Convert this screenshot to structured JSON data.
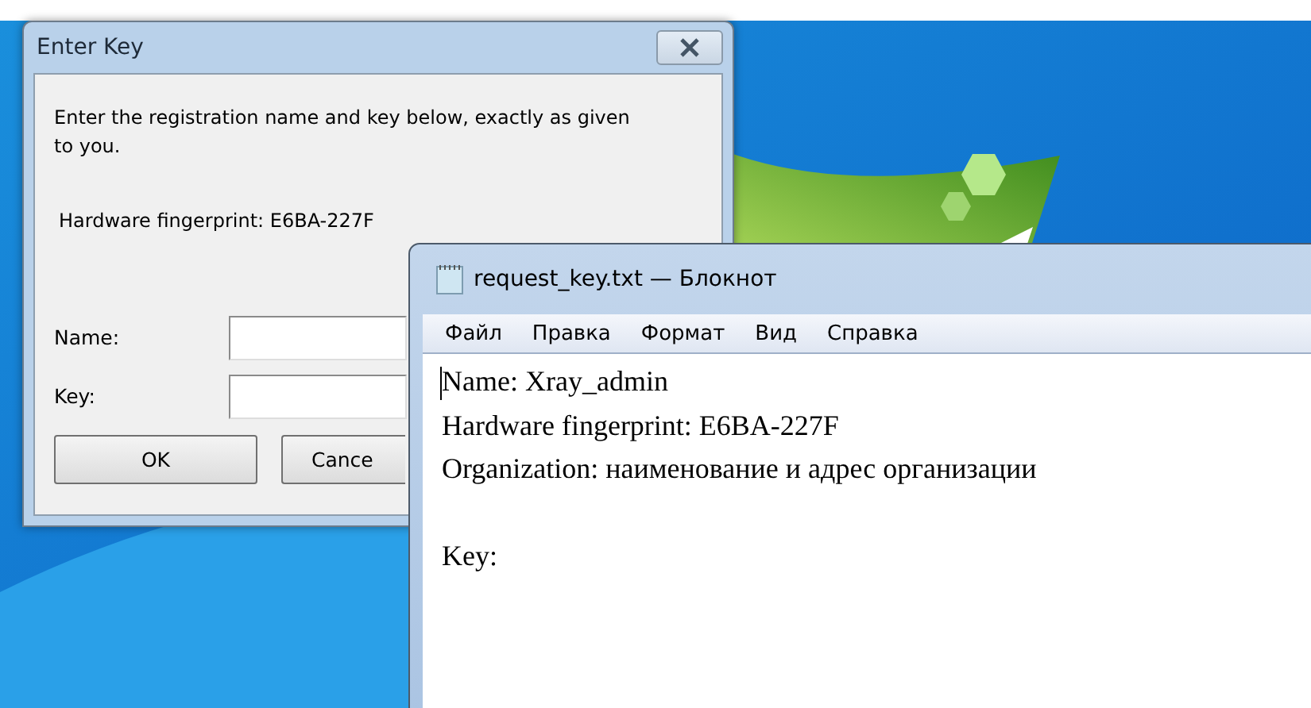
{
  "dialog": {
    "title": "Enter Key",
    "instructions": "Enter the registration name and key below, exactly as given to you.",
    "fingerprint": "Hardware fingerprint: E6BA-227F",
    "fields": [
      {
        "label": "Name:"
      },
      {
        "label": "Key:"
      }
    ],
    "buttons": [
      "OK",
      "Cance"
    ]
  },
  "notepad": {
    "title": "request_key.txt — Блокнот",
    "menu": [
      "Файл",
      "Правка",
      "Формат",
      "Вид",
      "Справка"
    ],
    "lines": [
      "Name: Xray_admin",
      "Hardware fingerprint: E6BA-227F",
      "Organization: наименование и адрес организации"
    ],
    "key_line": "Key:"
  }
}
